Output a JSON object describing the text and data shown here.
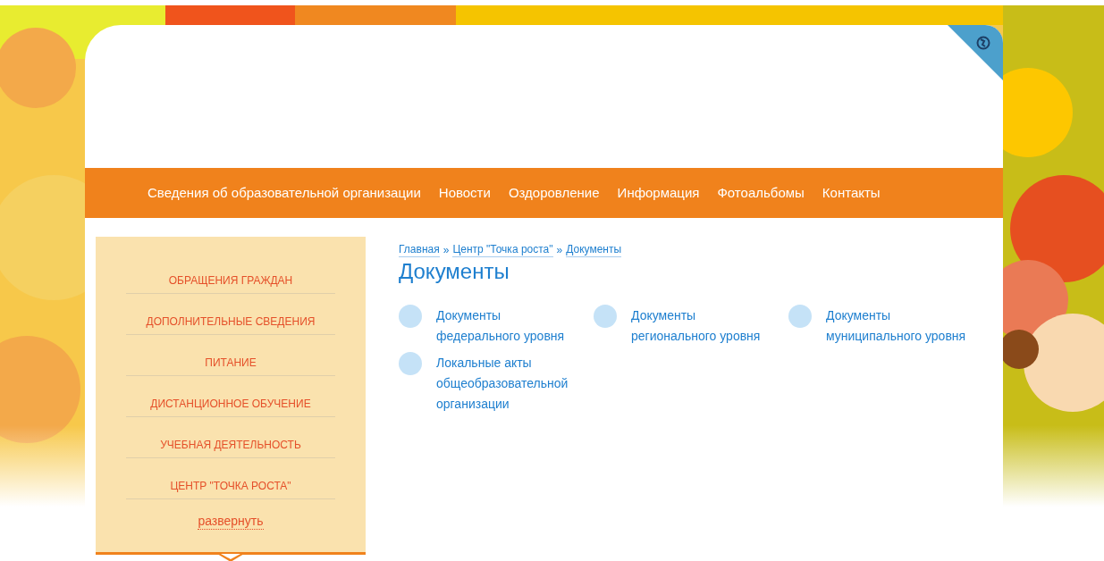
{
  "nav": {
    "items": [
      {
        "label": "Сведения об образовательной организации"
      },
      {
        "label": "Новости"
      },
      {
        "label": "Оздоровление"
      },
      {
        "label": "Информация"
      },
      {
        "label": "Фотоальбомы"
      },
      {
        "label": "Контакты"
      }
    ]
  },
  "sidebar": {
    "items": [
      {
        "label": "ОБРАЩЕНИЯ ГРАЖДАН"
      },
      {
        "label": "ДОПОЛНИТЕЛЬНЫЕ СВЕДЕНИЯ"
      },
      {
        "label": "ПИТАНИЕ"
      },
      {
        "label": "ДИСТАНЦИОННОЕ ОБУЧЕНИЕ"
      },
      {
        "label": "УЧЕБНАЯ ДЕЯТЕЛЬНОСТЬ"
      },
      {
        "label": "ЦЕНТР \"ТОЧКА РОСТА\""
      }
    ],
    "expand_link": "развернуть"
  },
  "breadcrumb": {
    "separator": "»",
    "items": [
      "Главная",
      "Центр \"Точка роста\"",
      "Документы"
    ]
  },
  "title": "Документы",
  "documents": [
    {
      "label": "Документы федерального уровня"
    },
    {
      "label": "Документы регионального уровня"
    },
    {
      "label": "Документы муниципального уровня"
    },
    {
      "label": "Локальные акты общеобразовательной организации"
    }
  ]
}
